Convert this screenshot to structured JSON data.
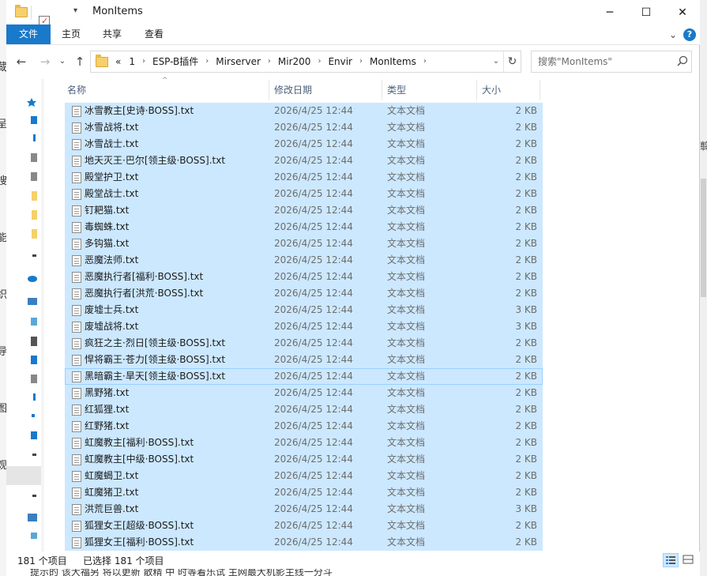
{
  "window": {
    "title": "MonItems",
    "minimize_glyph": "─",
    "maximize_glyph": "☐",
    "close_glyph": "✕"
  },
  "ribbon": {
    "tabs": [
      "文件",
      "主页",
      "共享",
      "查看"
    ],
    "expand_glyph": "⌄",
    "help_glyph": "?"
  },
  "nav": {
    "back_glyph": "←",
    "forward_glyph": "→",
    "recent_glyph": "⌄",
    "up_glyph": "↑",
    "overflow": "«",
    "breadcrumbs": [
      "1",
      "ESP-B插件",
      "Mirserver",
      "Mir200",
      "Envir",
      "MonItems"
    ],
    "crumb_sep": "›",
    "refresh_glyph": "↻"
  },
  "search": {
    "placeholder": "搜索\"MonItems\""
  },
  "columns": {
    "name": "名称",
    "date": "修改日期",
    "type": "类型",
    "size": "大小"
  },
  "files": [
    {
      "name": "冰雪教主[史诗·BOSS].txt",
      "date": "2026/4/25 12:44",
      "type": "文本文档",
      "size": "2 KB"
    },
    {
      "name": "冰雪战将.txt",
      "date": "2026/4/25 12:44",
      "type": "文本文档",
      "size": "2 KB"
    },
    {
      "name": "冰雪战士.txt",
      "date": "2026/4/25 12:44",
      "type": "文本文档",
      "size": "2 KB"
    },
    {
      "name": "地天灭王·巴尔[领主级·BOSS].txt",
      "date": "2026/4/25 12:44",
      "type": "文本文档",
      "size": "2 KB"
    },
    {
      "name": "殿堂护卫.txt",
      "date": "2026/4/25 12:44",
      "type": "文本文档",
      "size": "2 KB"
    },
    {
      "name": "殿堂战士.txt",
      "date": "2026/4/25 12:44",
      "type": "文本文档",
      "size": "2 KB"
    },
    {
      "name": "钉耙猫.txt",
      "date": "2026/4/25 12:44",
      "type": "文本文档",
      "size": "2 KB"
    },
    {
      "name": "毒蜘蛛.txt",
      "date": "2026/4/25 12:44",
      "type": "文本文档",
      "size": "2 KB"
    },
    {
      "name": "多钩猫.txt",
      "date": "2026/4/25 12:44",
      "type": "文本文档",
      "size": "2 KB"
    },
    {
      "name": "恶魔法师.txt",
      "date": "2026/4/25 12:44",
      "type": "文本文档",
      "size": "2 KB"
    },
    {
      "name": "恶魔执行者[福利·BOSS].txt",
      "date": "2026/4/25 12:44",
      "type": "文本文档",
      "size": "2 KB"
    },
    {
      "name": "恶魔执行者[洪荒·BOSS].txt",
      "date": "2026/4/25 12:44",
      "type": "文本文档",
      "size": "2 KB"
    },
    {
      "name": "废墟士兵.txt",
      "date": "2026/4/25 12:44",
      "type": "文本文档",
      "size": "3 KB"
    },
    {
      "name": "废墟战将.txt",
      "date": "2026/4/25 12:44",
      "type": "文本文档",
      "size": "3 KB"
    },
    {
      "name": "疯狂之主·烈日[领主级·BOSS].txt",
      "date": "2026/4/25 12:44",
      "type": "文本文档",
      "size": "2 KB"
    },
    {
      "name": "悍将霸王·苍力[领主级·BOSS].txt",
      "date": "2026/4/25 12:44",
      "type": "文本文档",
      "size": "2 KB"
    },
    {
      "name": "黑暗霸主·旱天[领主级·BOSS].txt",
      "date": "2026/4/25 12:44",
      "type": "文本文档",
      "size": "2 KB"
    },
    {
      "name": "黑野猪.txt",
      "date": "2026/4/25 12:44",
      "type": "文本文档",
      "size": "2 KB"
    },
    {
      "name": "红狐狸.txt",
      "date": "2026/4/25 12:44",
      "type": "文本文档",
      "size": "2 KB"
    },
    {
      "name": "红野猪.txt",
      "date": "2026/4/25 12:44",
      "type": "文本文档",
      "size": "2 KB"
    },
    {
      "name": "虹魔教主[福利·BOSS].txt",
      "date": "2026/4/25 12:44",
      "type": "文本文档",
      "size": "2 KB"
    },
    {
      "name": "虹魔教主[中级·BOSS].txt",
      "date": "2026/4/25 12:44",
      "type": "文本文档",
      "size": "2 KB"
    },
    {
      "name": "虹魔蝎卫.txt",
      "date": "2026/4/25 12:44",
      "type": "文本文档",
      "size": "2 KB"
    },
    {
      "name": "虹魔猪卫.txt",
      "date": "2026/4/25 12:44",
      "type": "文本文档",
      "size": "2 KB"
    },
    {
      "name": "洪荒巨兽.txt",
      "date": "2026/4/25 12:44",
      "type": "文本文档",
      "size": "3 KB"
    },
    {
      "name": "狐狸女王[超级·BOSS].txt",
      "date": "2026/4/25 12:44",
      "type": "文本文档",
      "size": "2 KB"
    },
    {
      "name": "狐狸女王[福利·BOSS].txt",
      "date": "2026/4/25 12:44",
      "type": "文本文档",
      "size": "2 KB"
    }
  ],
  "status": {
    "item_count": "181 个项目",
    "selected": "已选择 181 个项目"
  },
  "colors": {
    "accent": "#1979ca",
    "selection": "#cce8ff",
    "selection_border": "#99d1ff",
    "folder": "#f6d06a"
  }
}
